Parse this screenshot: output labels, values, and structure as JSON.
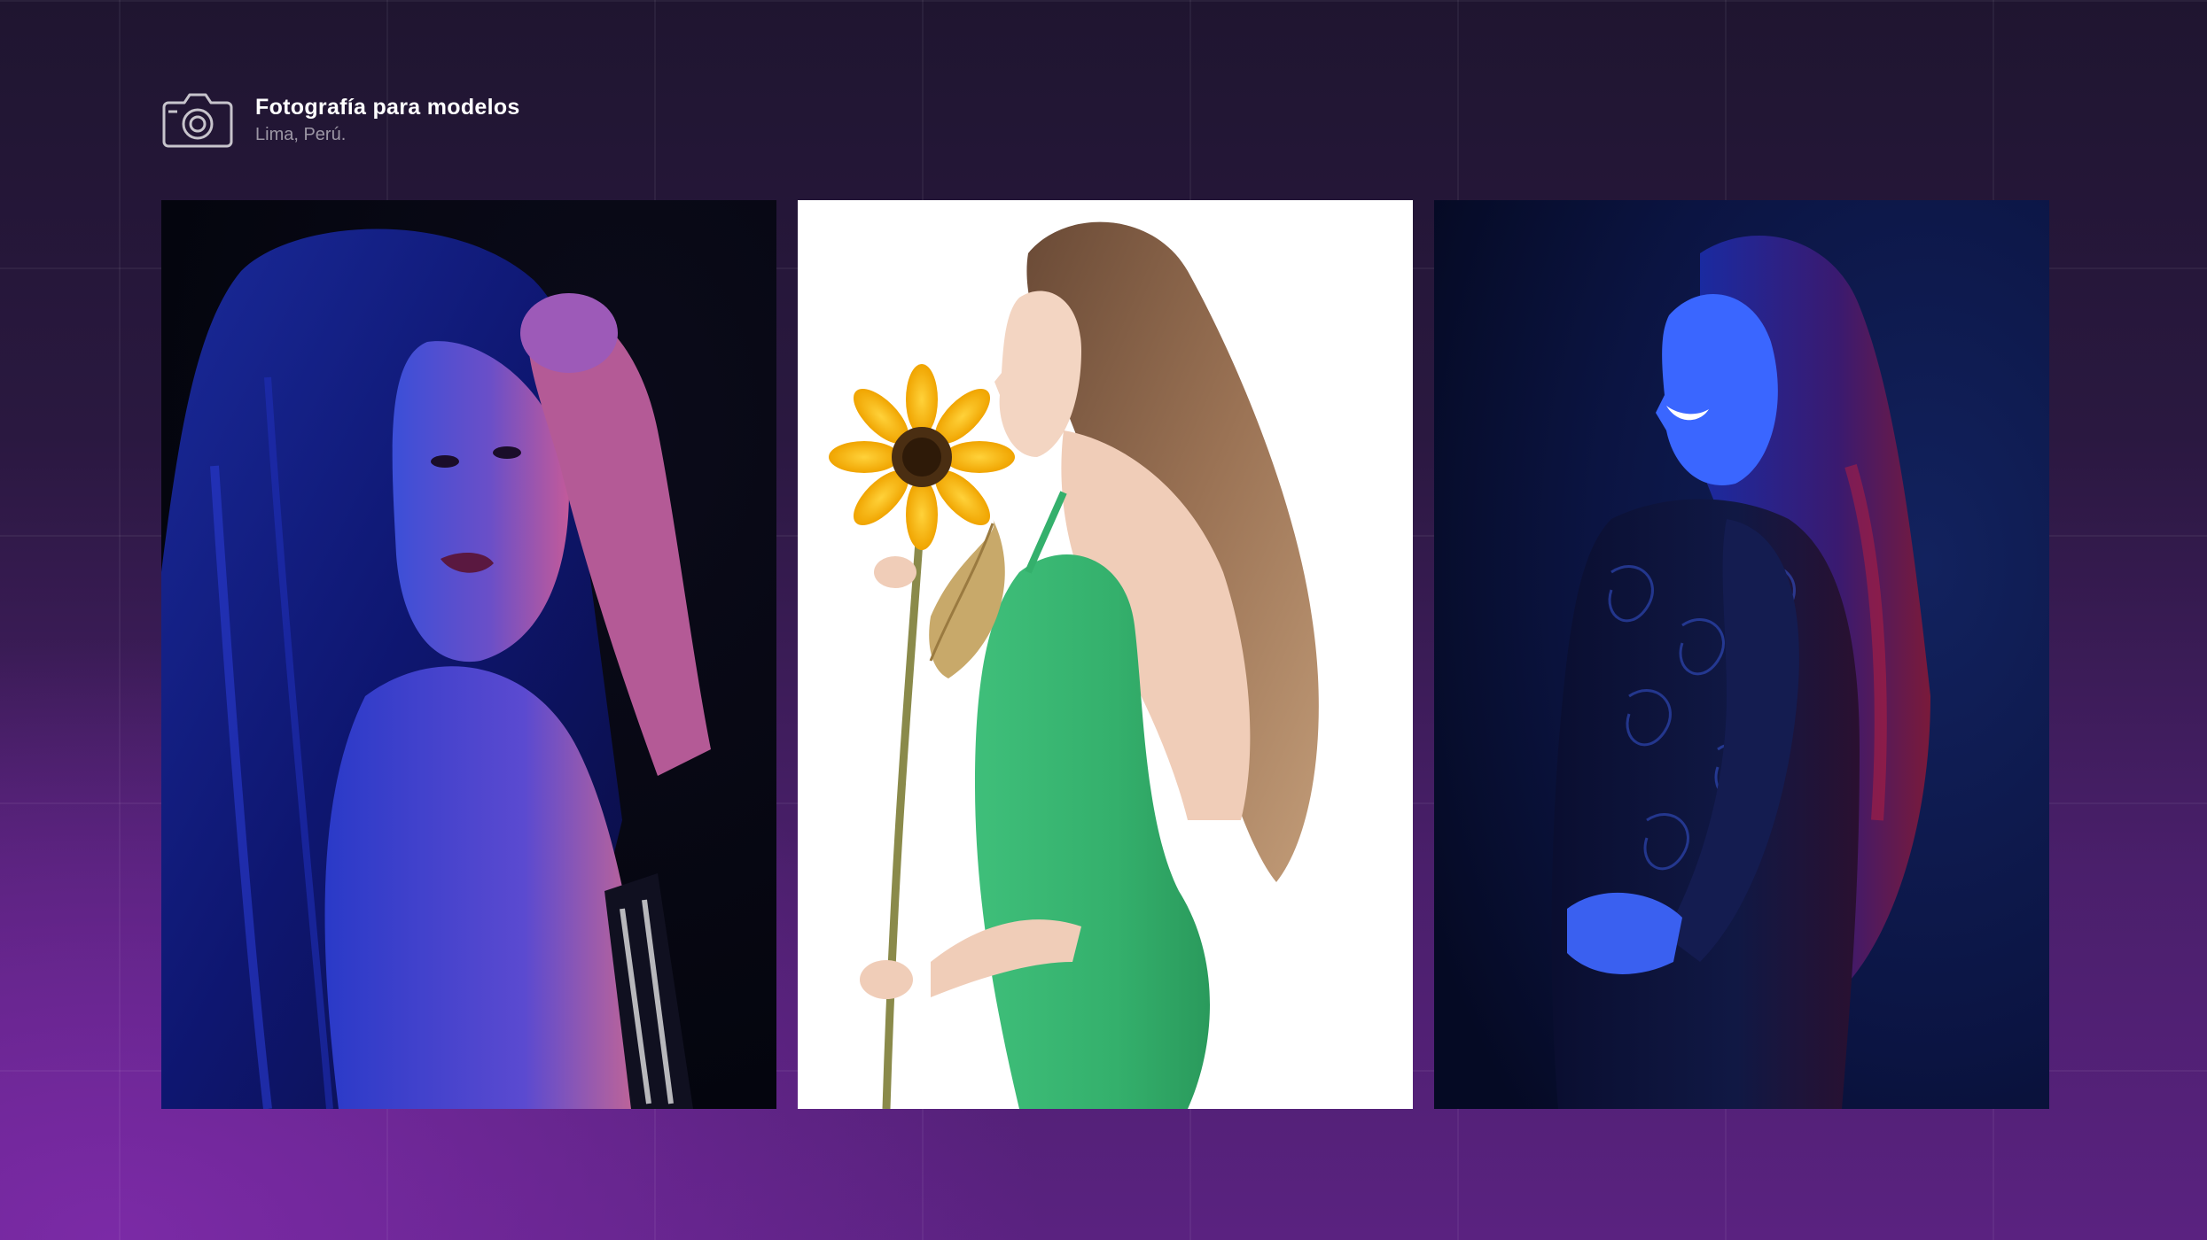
{
  "header": {
    "icon": "camera-icon",
    "title": "Fotografía para modelos",
    "location": "Lima, Perú."
  },
  "gallery": {
    "photos": [
      {
        "subject": "Woman with long dark hair, hand in hair, looking back over shoulder, blue and pink lighting",
        "background": "#060712"
      },
      {
        "subject": "Woman in green halter dress smelling a sunflower, profile view",
        "background": "#ffffff"
      },
      {
        "subject": "Smiling woman in black lace dress, blue and red lighting",
        "background": "#081031"
      }
    ]
  },
  "colors": {
    "background_top": "#1f1530",
    "background_bottom": "#5a2280",
    "accent": "#7b2aa6"
  }
}
